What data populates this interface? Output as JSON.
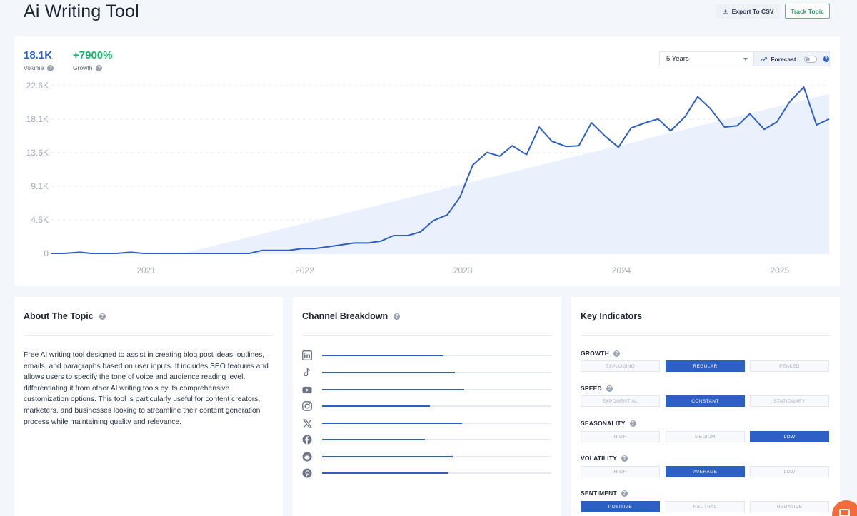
{
  "page": {
    "title": "Ai Writing Tool"
  },
  "toolbar": {
    "export_label": "Export To CSV",
    "track_label": "Track Topic"
  },
  "metrics": {
    "volume": {
      "value": "18.1K",
      "label": "Volume"
    },
    "growth": {
      "value": "+7900%",
      "label": "Growth",
      "color": "#1bb36a"
    }
  },
  "controls": {
    "range_value": "5 Years",
    "forecast_label": "Forecast",
    "forecast_enabled": false
  },
  "chart_data": {
    "type": "line",
    "title": "",
    "xlabel": "",
    "ylabel": "",
    "yticks": [
      "0",
      "4.5K",
      "9.1K",
      "13.6K",
      "18.1K",
      "22.6K"
    ],
    "ylim": [
      0,
      22600
    ],
    "xticks": [
      "2021",
      "2022",
      "2023",
      "2024",
      "2025"
    ],
    "x_range": [
      2020.42,
      2025.33
    ],
    "grid": "horizontal-dashed",
    "series": [
      {
        "color": "#2d5fc4",
        "x": [
          2020.42,
          2020.5,
          2020.6,
          2020.67,
          2020.75,
          2020.83,
          2020.92,
          2021.0,
          2021.08,
          2021.17,
          2021.25,
          2021.5,
          2021.67,
          2021.75,
          2021.83,
          2021.92,
          2022.0,
          2022.08,
          2022.17,
          2022.25,
          2022.33,
          2022.42,
          2022.5,
          2022.58,
          2022.67,
          2022.75,
          2022.83,
          2022.92,
          2023.0,
          2023.08,
          2023.17,
          2023.25,
          2023.33,
          2023.42,
          2023.5,
          2023.58,
          2023.67,
          2023.75,
          2023.83,
          2023.92,
          2024.0,
          2024.08,
          2024.17,
          2024.25,
          2024.33,
          2024.42,
          2024.5,
          2024.58,
          2024.67,
          2024.75,
          2024.83,
          2024.92,
          2025.0,
          2025.08,
          2025.17,
          2025.25,
          2025.33
        ],
        "values": [
          0,
          0,
          150,
          0,
          0,
          0,
          150,
          0,
          0,
          0,
          0,
          0,
          0,
          400,
          400,
          400,
          650,
          650,
          900,
          1150,
          1400,
          1400,
          1650,
          2400,
          2400,
          2900,
          4400,
          5200,
          7600,
          11900,
          13600,
          13100,
          14500,
          13300,
          17000,
          15100,
          14400,
          14500,
          17600,
          15700,
          14300,
          16900,
          17600,
          18100,
          16500,
          18400,
          21100,
          19500,
          17000,
          17200,
          18800,
          16700,
          17700,
          20400,
          22400,
          17300,
          18100
        ]
      }
    ],
    "trend_band": {
      "values_from": 0,
      "values_to": 21500,
      "from_x": 2021.25,
      "to_x": 2025.33
    }
  },
  "about": {
    "title": "About The Topic",
    "text": "Free AI writing tool designed to assist in creating blog post ideas, outlines, emails, and paragraphs based on user inputs. It includes SEO features and allows users to specify the tone of voice and audience reading level, differentiating it from other AI writing tools by its comprehensive customization options. This tool is particularly useful for content creators, marketers, and businesses looking to streamline their content generation process while maintaining quality and relevance."
  },
  "channels": {
    "title": "Channel Breakdown",
    "items": [
      {
        "icon": "linkedin-icon",
        "share": 0.53
      },
      {
        "icon": "tiktok-icon",
        "share": 0.58
      },
      {
        "icon": "youtube-icon",
        "share": 0.62
      },
      {
        "icon": "instagram-icon",
        "share": 0.47
      },
      {
        "icon": "x-icon",
        "share": 0.61
      },
      {
        "icon": "facebook-icon",
        "share": 0.45
      },
      {
        "icon": "reddit-icon",
        "share": 0.57
      },
      {
        "icon": "pinterest-icon",
        "share": 0.55
      }
    ]
  },
  "indicators": {
    "title": "Key Indicators",
    "rows": [
      {
        "label": "GROWTH",
        "options": [
          "EXPLODING",
          "REGULAR",
          "PEAKED"
        ],
        "selected": 1
      },
      {
        "label": "SPEED",
        "options": [
          "EXPONENTIAL",
          "CONSTANT",
          "STATIONARY"
        ],
        "selected": 1
      },
      {
        "label": "SEASONALITY",
        "options": [
          "HIGH",
          "MEDIUM",
          "LOW"
        ],
        "selected": 2
      },
      {
        "label": "VOLATILITY",
        "options": [
          "HIGH",
          "AVERAGE",
          "LOW"
        ],
        "selected": 1
      },
      {
        "label": "SENTIMENT",
        "options": [
          "POSITIVE",
          "NEUTRAL",
          "NEGATIVE"
        ],
        "selected": 0
      }
    ]
  },
  "colors": {
    "accent": "#2d5fc4",
    "positive": "#1bb36a",
    "track_border": "#4fbf8a"
  }
}
